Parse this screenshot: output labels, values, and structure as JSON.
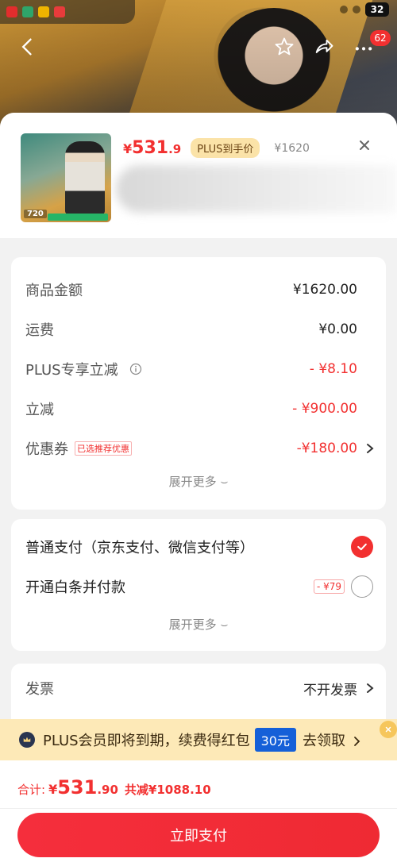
{
  "status_bar": {
    "battery": "32"
  },
  "nav": {
    "message_badge": "62"
  },
  "product": {
    "price_yen": "¥",
    "price_int": "531",
    "price_dec": ".9",
    "plus_tag": "PLUS到手价",
    "original_price": "¥1620",
    "thumb_price": "720"
  },
  "fees": {
    "items": [
      {
        "label": "商品金额",
        "value": "¥1620.00"
      },
      {
        "label": "运费",
        "value": "¥0.00"
      },
      {
        "label": "PLUS专享立减",
        "value": "- ¥8.10"
      },
      {
        "label": "立减",
        "value": "- ¥900.00"
      },
      {
        "label": "优惠券",
        "tag": "已选推荐优惠",
        "value": "-¥180.00"
      }
    ],
    "expand_more": "展开更多 ⌣"
  },
  "payment": {
    "options": [
      {
        "label": "普通支付（京东支付、微信支付等）",
        "selected": true
      },
      {
        "label": "开通白条并付款",
        "discount": "- ¥79",
        "selected": false
      }
    ],
    "expand_more": "展开更多 ⌣"
  },
  "invoice": {
    "label": "发票",
    "value": "不开发票"
  },
  "promo": {
    "text": "PLUS会员即将到期，续费得红包",
    "amount": "30元",
    "claim": "去领取"
  },
  "summary": {
    "label": "合计:",
    "yen": "¥",
    "total_int": "531",
    "total_dec": ".90",
    "saved": "共减¥1088.10"
  },
  "pay_button": "立即支付",
  "colors": {
    "accent": "#f23030",
    "promo_bg": "#fde9b7",
    "plus_tag_bg": "#fbe3a8"
  }
}
